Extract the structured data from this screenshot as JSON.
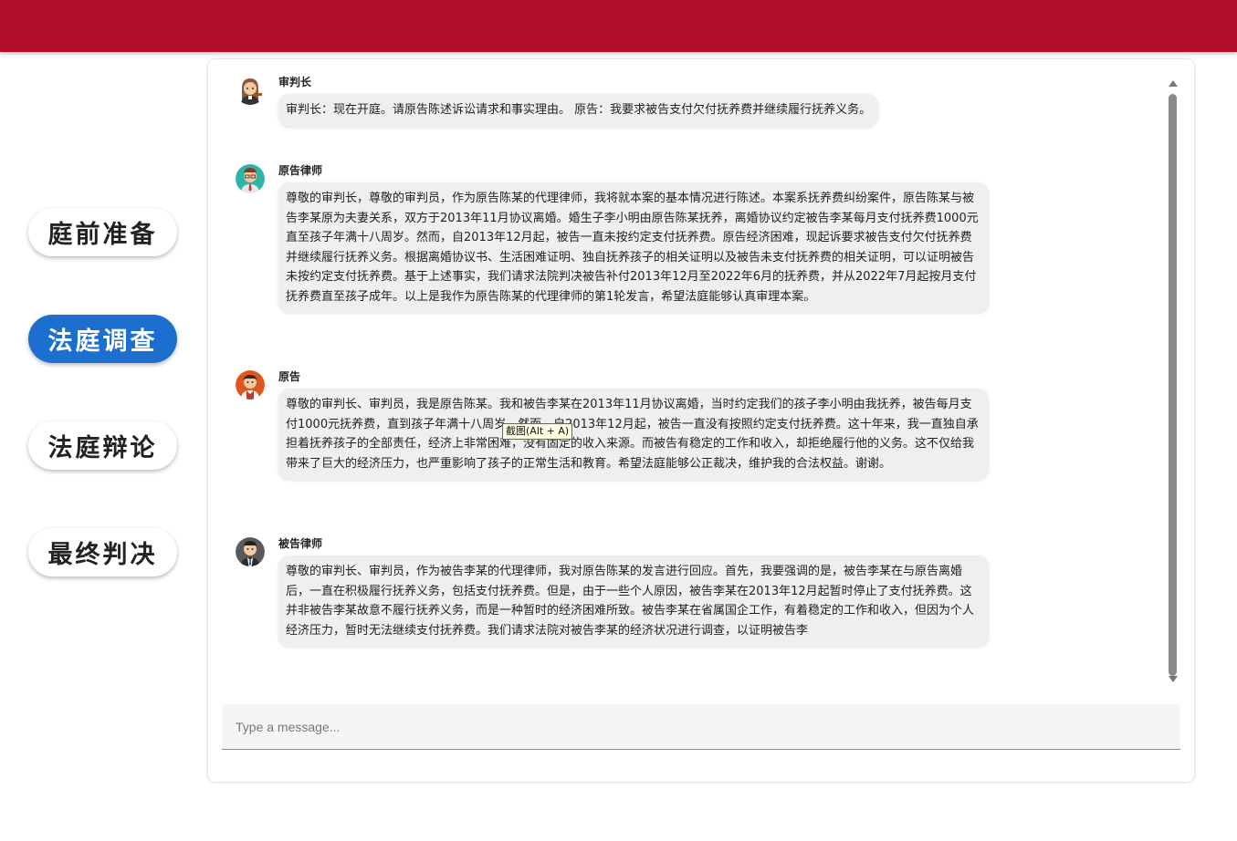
{
  "stages": [
    {
      "label": "庭前准备",
      "active": false
    },
    {
      "label": "法庭调查",
      "active": true
    },
    {
      "label": "法庭辩论",
      "active": false
    },
    {
      "label": "最终判决",
      "active": false
    }
  ],
  "messages": [
    {
      "sender": "审判长",
      "avatar": "judge-avatar-icon",
      "text": "审判长：现在开庭。请原告陈述诉讼请求和事实理由。 原告：我要求被告支付欠付抚养费并继续履行抚养义务。"
    },
    {
      "sender": "原告律师",
      "avatar": "plaintiff-lawyer-avatar-icon",
      "text": "尊敬的审判长，尊敬的审判员，作为原告陈某的代理律师，我将就本案的基本情况进行陈述。本案系抚养费纠纷案件，原告陈某与被告李某原为夫妻关系，双方于2013年11月协议离婚。婚生子李小明由原告陈某抚养，离婚协议约定被告李某每月支付抚养费1000元直至孩子年满十八周岁。然而，自2013年12月起，被告一直未按约定支付抚养费。原告经济困难，现起诉要求被告支付欠付抚养费并继续履行抚养义务。根据离婚协议书、生活困难证明、独自抚养孩子的相关证明以及被告未支付抚养费的相关证明，可以证明被告未按约定支付抚养费。基于上述事实，我们请求法院判决被告补付2013年12月至2022年6月的抚养费，并从2022年7月起按月支付抚养费直至孩子成年。以上是我作为原告陈某的代理律师的第1轮发言，希望法庭能够认真审理本案。"
    },
    {
      "sender": "原告",
      "avatar": "plaintiff-avatar-icon",
      "text": "尊敬的审判长、审判员，我是原告陈某。我和被告李某在2013年11月协议离婚，当时约定我们的孩子李小明由我抚养，被告每月支付1000元抚养费，直到孩子年满十八周岁。然而，自2013年12月起，被告一直没有按照约定支付抚养费。这十年来，我一直独自承担着抚养孩子的全部责任，经济上非常困难，没有固定的收入来源。而被告有稳定的工作和收入，却拒绝履行他的义务。这不仅给我带来了巨大的经济压力，也严重影响了孩子的正常生活和教育。希望法庭能够公正裁决，维护我的合法权益。谢谢。"
    },
    {
      "sender": "被告律师",
      "avatar": "defendant-lawyer-avatar-icon",
      "text": "尊敬的审判长、审判员，作为被告李某的代理律师，我对原告陈某的发言进行回应。首先，我要强调的是，被告李某在与原告离婚后，一直在积极履行抚养义务，包括支付抚养费。但是，由于一些个人原因，被告李某在2013年12月起暂时停止了支付抚养费。这并非被告李某故意不履行抚养义务，而是一种暂时的经济困难所致。被告李某在省属国企工作，有着稳定的工作和收入，但因为个人经济压力，暂时无法继续支付抚养费。我们请求法院对被告李某的经济状况进行调查，以证明被告李"
    }
  ],
  "input": {
    "placeholder": "Type a message..."
  },
  "tooltip": "截图(Alt + A)",
  "colors": {
    "header": "#b00e2a",
    "active_stage": "#1d6fcf"
  }
}
